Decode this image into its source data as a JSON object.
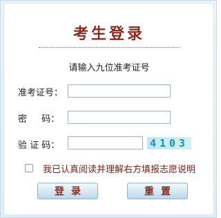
{
  "form": {
    "title": "考生登录",
    "hint": "请输入九位准考证号",
    "fields": [
      {
        "label": "准考证号：",
        "value": "",
        "placeholder": ""
      },
      {
        "label": "密　  码：",
        "value": "",
        "placeholder": ""
      },
      {
        "label": "验 证 码：",
        "value": "",
        "placeholder": ""
      }
    ],
    "captcha_text": "4103",
    "agreement_label": "我已认真阅读并理解右方填报志愿说明",
    "agreement_checked": false,
    "login_label": "登录",
    "reset_label": "重置"
  },
  "colors": {
    "title": "#8b2b1e",
    "agreement": "#7a1b12",
    "captcha": "#1b8fb5"
  }
}
